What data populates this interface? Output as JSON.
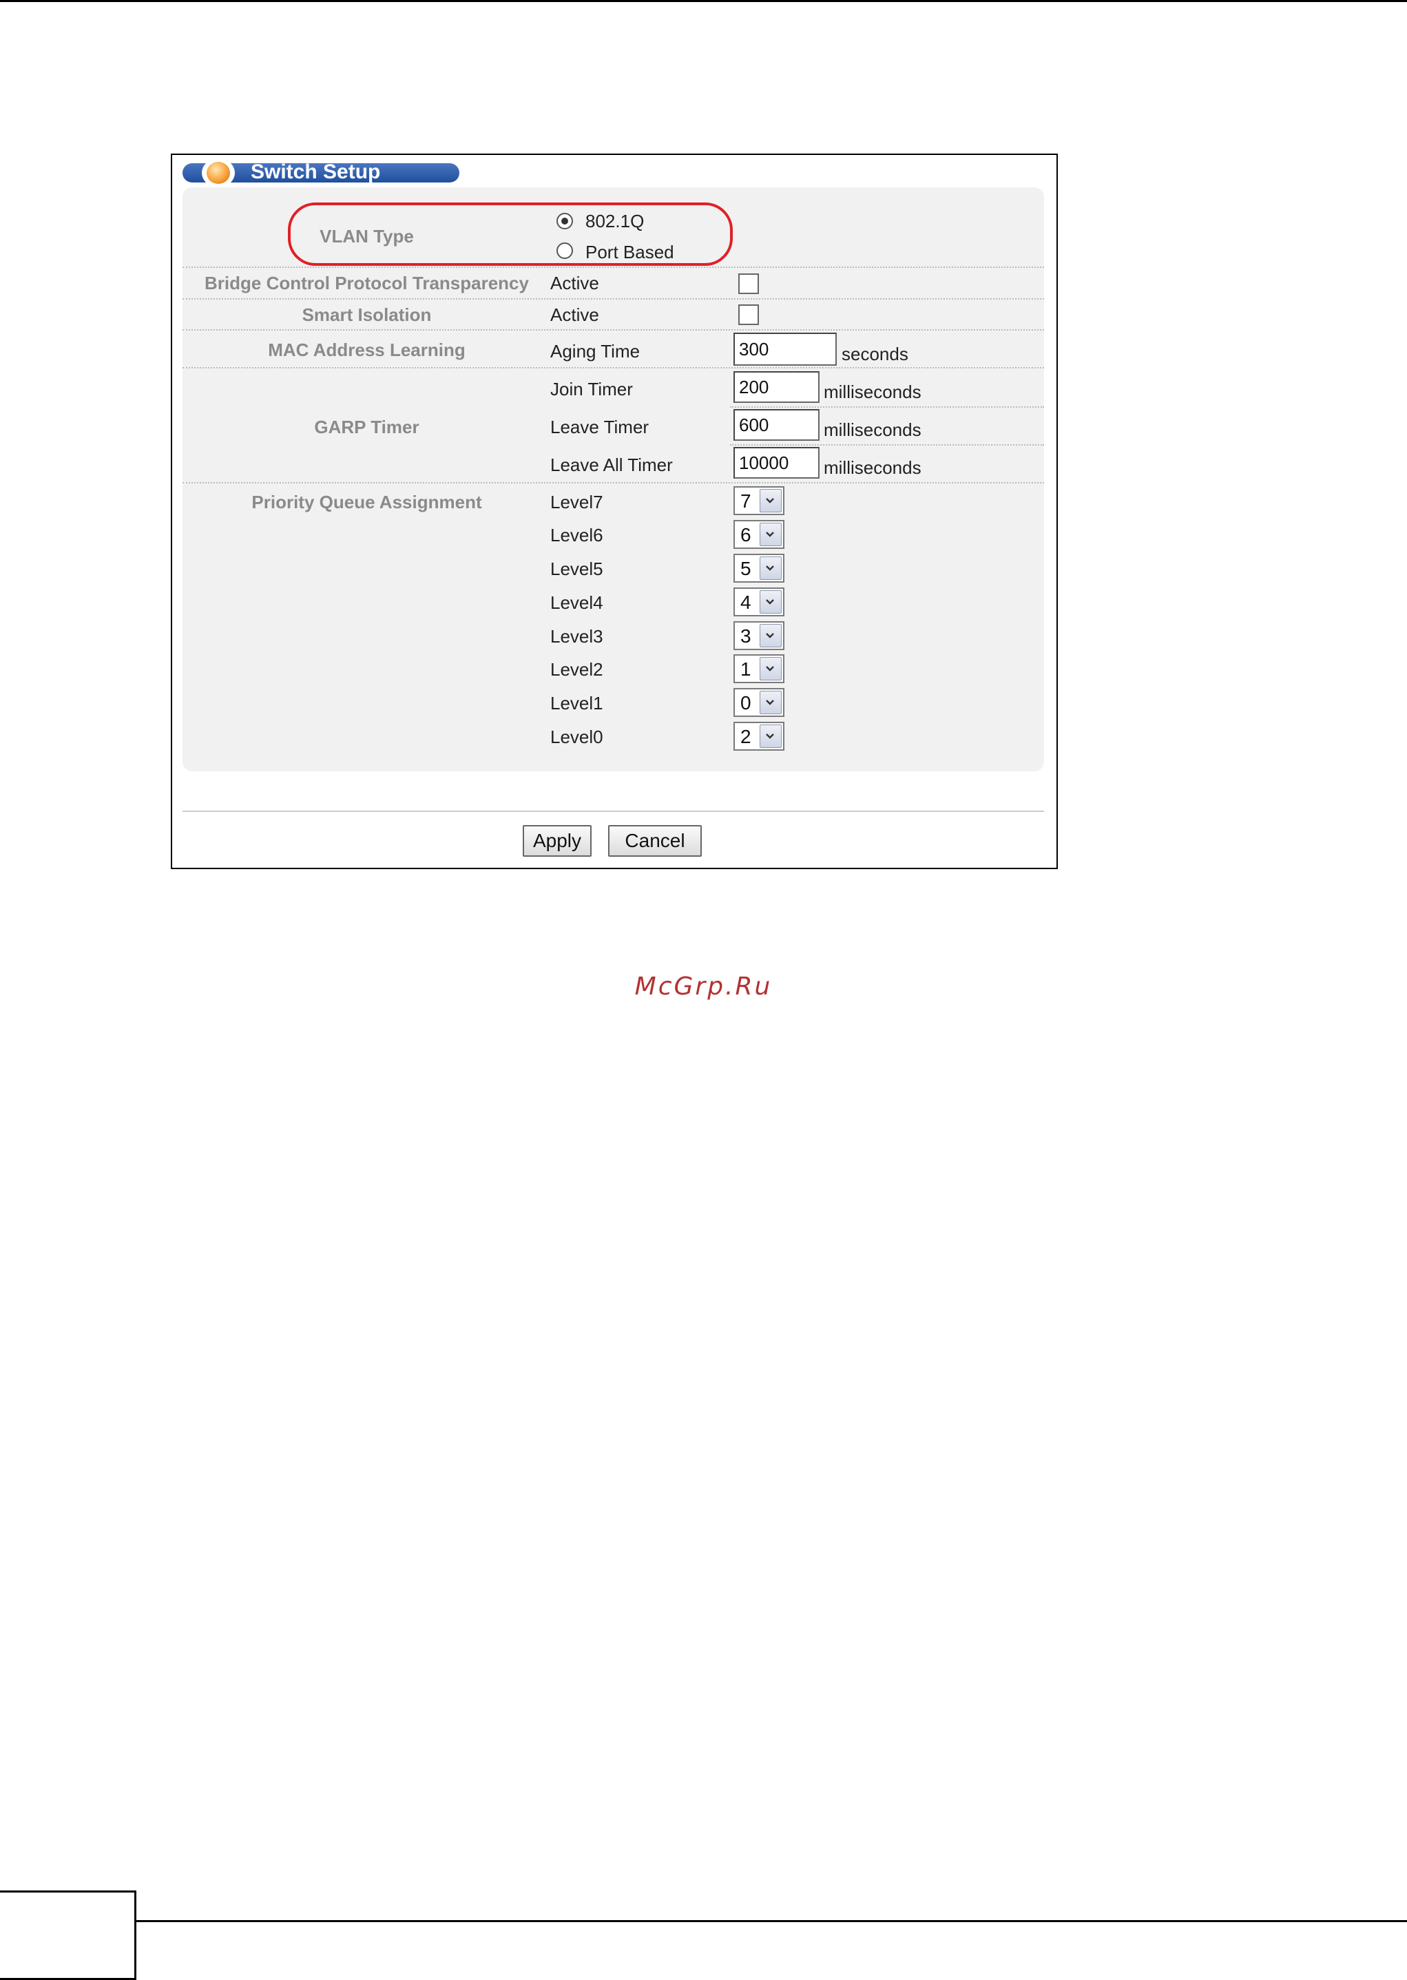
{
  "title": "Switch Setup",
  "vlan_type": {
    "label": "VLAN Type",
    "options": [
      {
        "label": "802.1Q",
        "selected": true
      },
      {
        "label": "Port Based",
        "selected": false
      }
    ]
  },
  "bridge_control": {
    "label": "Bridge Control Protocol Transparency",
    "field": "Active",
    "checked": false
  },
  "smart_isolation": {
    "label": "Smart Isolation",
    "field": "Active",
    "checked": false
  },
  "mac_learning": {
    "label": "MAC Address Learning",
    "field": "Aging Time",
    "value": "300",
    "unit": "seconds"
  },
  "garp": {
    "label": "GARP Timer",
    "join": {
      "field": "Join Timer",
      "value": "200",
      "unit": "milliseconds"
    },
    "leave": {
      "field": "Leave Timer",
      "value": "600",
      "unit": "milliseconds"
    },
    "leave_all": {
      "field": "Leave All Timer",
      "value": "10000",
      "unit": "milliseconds"
    }
  },
  "priority_queue": {
    "label": "Priority Queue Assignment",
    "levels": [
      {
        "label": "Level7",
        "value": "7"
      },
      {
        "label": "Level6",
        "value": "6"
      },
      {
        "label": "Level5",
        "value": "5"
      },
      {
        "label": "Level4",
        "value": "4"
      },
      {
        "label": "Level3",
        "value": "3"
      },
      {
        "label": "Level2",
        "value": "1"
      },
      {
        "label": "Level1",
        "value": "0"
      },
      {
        "label": "Level0",
        "value": "2"
      }
    ]
  },
  "buttons": {
    "apply": "Apply",
    "cancel": "Cancel"
  },
  "watermark": "McGrp.Ru",
  "colors": {
    "highlight": "#e11f26",
    "title_bar": "#2a5aa8",
    "label_gray": "#8a8a8a"
  }
}
